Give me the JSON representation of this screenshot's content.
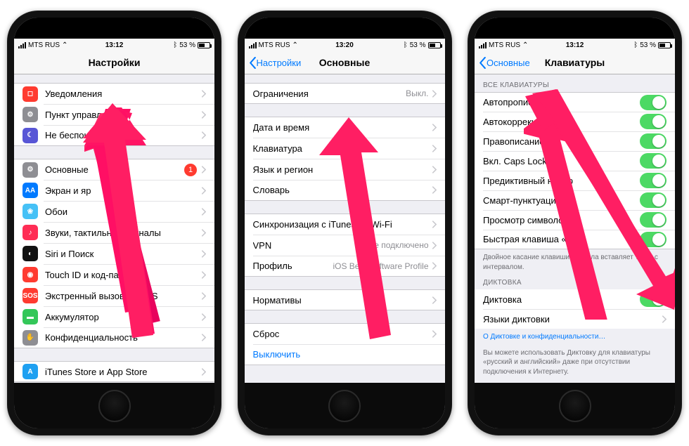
{
  "status": {
    "carrier": "MTS RUS",
    "net": "",
    "battery": "53 %",
    "bt": "✱"
  },
  "phone1": {
    "time": "13:12",
    "title": "Настройки",
    "group1": [
      {
        "icon_bg": "#ff3b30",
        "glyph": "◻",
        "label": "Уведомления"
      },
      {
        "icon_bg": "#8e8e93",
        "glyph": "⚙",
        "label": "Пункт управления"
      },
      {
        "icon_bg": "#5856d6",
        "glyph": "☾",
        "label": "Не беспокоить"
      }
    ],
    "group2": [
      {
        "icon_bg": "#8e8e93",
        "glyph": "⚙",
        "label": "Основные",
        "badge": "1"
      },
      {
        "icon_bg": "#007aff",
        "glyph": "AA",
        "label": "Экран и яр"
      },
      {
        "icon_bg": "#46c1f6",
        "glyph": "❀",
        "label": "Обои"
      },
      {
        "icon_bg": "#ff2d55",
        "glyph": "♪",
        "label": "Звуки, тактильные сигналы"
      },
      {
        "icon_bg": "#111",
        "glyph": "◐",
        "label": "Siri и Поиск"
      },
      {
        "icon_bg": "#ff3b30",
        "glyph": "◉",
        "label": "Touch ID и код-пароль"
      },
      {
        "icon_bg": "#ff3b30",
        "glyph": "SOS",
        "label": "Экстренный вызов — SOS"
      },
      {
        "icon_bg": "#34c759",
        "glyph": "▬",
        "label": "Аккумулятор"
      },
      {
        "icon_bg": "#8e8e93",
        "glyph": "✋",
        "label": "Конфиденциальность"
      }
    ],
    "group3": [
      {
        "icon_bg": "#1ea0f1",
        "glyph": "A",
        "label": "iTunes Store и App Store"
      }
    ]
  },
  "phone2": {
    "time": "13:20",
    "back": "Настройки",
    "title": "Основные",
    "rows": {
      "restrictions": "Ограничения",
      "restrictions_val": "Выкл.",
      "datetime": "Дата и время",
      "keyboard": "Клавиатура",
      "lang": "Язык и регион",
      "dict": "Словарь",
      "sync": "Синхронизация с iTunes по Wi-Fi",
      "vpn": "VPN",
      "vpn_val": "Не подключено",
      "profile": "Профиль",
      "profile_val": "iOS Beta Software Profile",
      "norms": "Нормативы",
      "reset": "Сброс",
      "shutdown": "Выключить"
    }
  },
  "phone3": {
    "time": "13:12",
    "back": "Основные",
    "title": "Клавиатуры",
    "h1": "ВСЕ КЛАВИАТУРЫ",
    "rows1": [
      "Автопрописные",
      "Автокоррекция",
      "Правописание",
      "Вкл. Caps Lock",
      "Предиктивный набор",
      "Смарт-пунктуация",
      "Просмотр символов",
      "Быстрая клавиша «.»"
    ],
    "footer1": "Двойное касание клавиши пробела вставляет точку с интервалом.",
    "h2": "ДИКТОВКА",
    "dictation": "Диктовка",
    "dict_langs": "Языки диктовки",
    "link": "О Диктовке и конфиденциальности…",
    "footer2": "Вы можете использовать Диктовку для клавиатуры «русский и английский» даже при отсутствии подключения к Интернету."
  }
}
